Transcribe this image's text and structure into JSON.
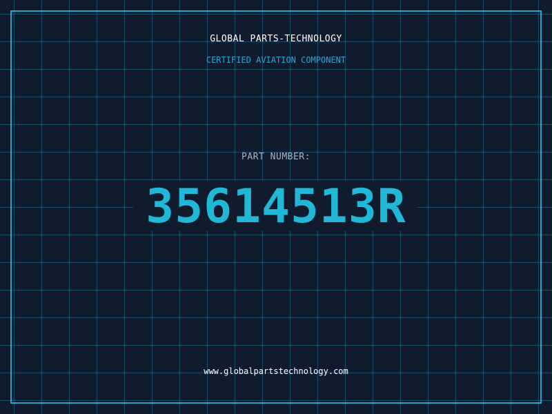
{
  "header": {
    "brand": "GLOBAL PARTS-TECHNOLOGY",
    "tagline": "CERTIFIED AVIATION COMPONENT"
  },
  "part": {
    "label": "PART NUMBER:",
    "number": "35614513R"
  },
  "footer": {
    "url": "www.globalpartstechnology.com"
  },
  "colors": {
    "background": "#101b2e",
    "grid": "#1c7696",
    "accent": "#21b8d8",
    "frame": "#1fa6c8"
  }
}
